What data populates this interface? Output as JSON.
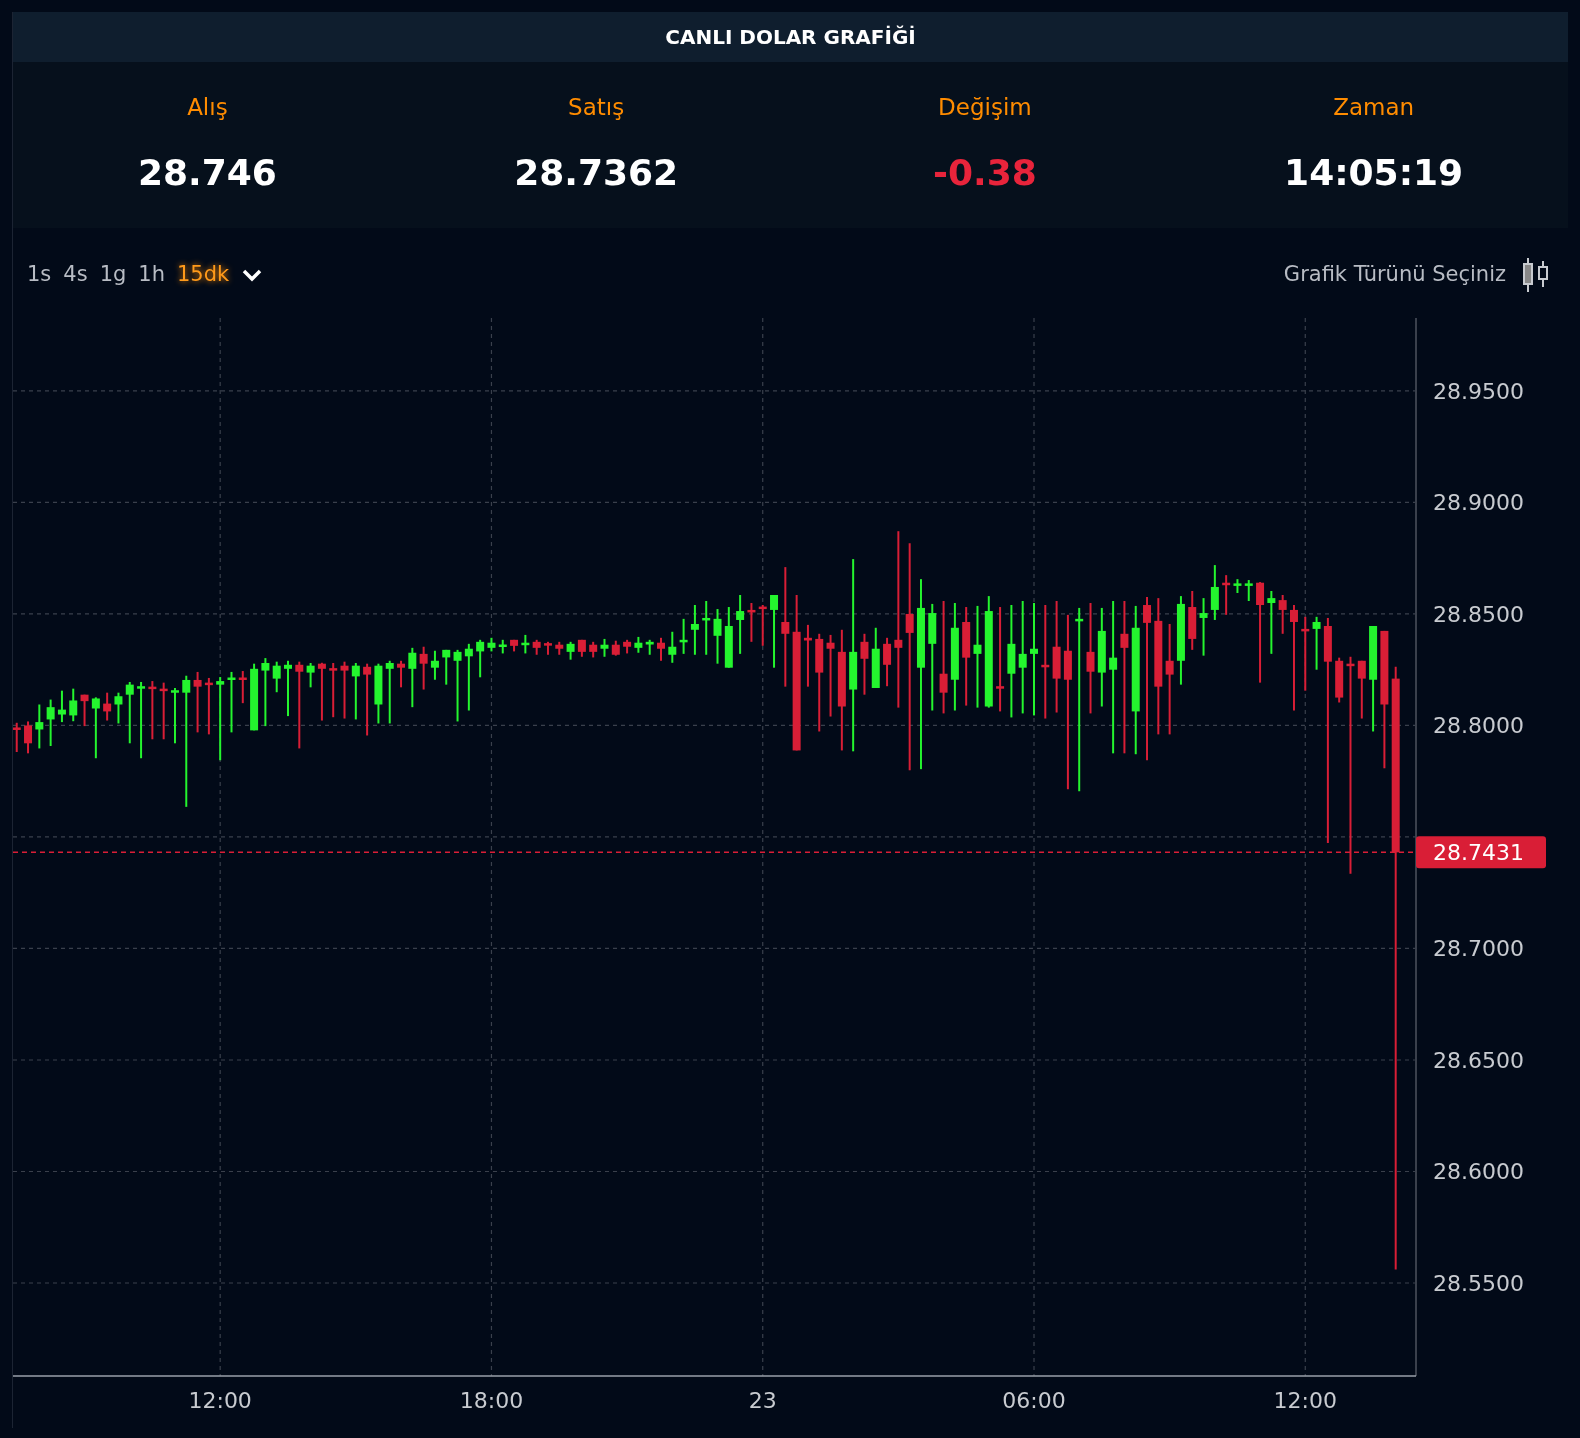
{
  "title": "CANLI DOLAR GRAFİĞİ",
  "stats": [
    {
      "label": "Alış",
      "value": "28.746",
      "color": "#ffffff"
    },
    {
      "label": "Satış",
      "value": "28.7362",
      "color": "#ffffff"
    },
    {
      "label": "Değişim",
      "value": "-0.38",
      "color": "#e8243b"
    },
    {
      "label": "Zaman",
      "value": "14:05:19",
      "color": "#ffffff"
    }
  ],
  "toolbar": {
    "intervals": [
      {
        "label": "1s",
        "selected": false
      },
      {
        "label": "4s",
        "selected": false
      },
      {
        "label": "1g",
        "selected": false
      },
      {
        "label": "1h",
        "selected": false
      },
      {
        "label": "15dk",
        "selected": true
      }
    ],
    "chart_type_label": "Grafik Türünü Seçiniz"
  },
  "chart_data": {
    "type": "candlestick",
    "ylim": [
      28.5083,
      28.9827
    ],
    "grid": true,
    "yticks": [
      {
        "value": 28.55,
        "label": "28.5500"
      },
      {
        "value": 28.6,
        "label": "28.6000"
      },
      {
        "value": 28.65,
        "label": "28.6500"
      },
      {
        "value": 28.7,
        "label": "28.7000"
      },
      {
        "value": 28.8,
        "label": "28.8000"
      },
      {
        "value": 28.85,
        "label": "28.8500"
      },
      {
        "value": 28.9,
        "label": "28.9000"
      },
      {
        "value": 28.95,
        "label": "28.9500"
      }
    ],
    "categories": [
      null,
      null,
      null,
      null,
      null,
      null,
      null,
      null,
      null,
      null,
      null,
      null,
      null,
      null,
      null,
      null,
      null,
      null,
      "12:00",
      null,
      null,
      null,
      null,
      null,
      null,
      null,
      null,
      null,
      null,
      null,
      null,
      null,
      null,
      null,
      null,
      null,
      null,
      null,
      null,
      null,
      null,
      null,
      "18:00",
      null,
      null,
      null,
      null,
      null,
      null,
      null,
      null,
      null,
      null,
      null,
      null,
      null,
      null,
      null,
      null,
      null,
      null,
      null,
      null,
      null,
      null,
      null,
      "23",
      null,
      null,
      null,
      null,
      null,
      null,
      null,
      null,
      null,
      null,
      null,
      null,
      null,
      null,
      null,
      null,
      null,
      null,
      null,
      null,
      null,
      null,
      null,
      "06:00",
      null,
      null,
      null,
      null,
      null,
      null,
      null,
      null,
      null,
      null,
      null,
      null,
      null,
      null,
      null,
      null,
      null,
      null,
      null,
      null,
      null,
      null,
      null,
      "12:00",
      null,
      null,
      null,
      null,
      null,
      null,
      null,
      null
    ],
    "ohlc": [
      [
        28.7991,
        28.8012,
        28.7881,
        28.7985
      ],
      [
        28.8,
        28.8018,
        28.7875,
        28.792
      ],
      [
        28.7982,
        28.8094,
        28.7897,
        28.8015
      ],
      [
        28.8027,
        28.8116,
        28.7908,
        28.8082
      ],
      [
        28.8049,
        28.8156,
        28.8015,
        28.8071
      ],
      [
        28.8045,
        28.8165,
        28.8019,
        28.8112
      ],
      [
        28.8138,
        28.8138,
        28.7997,
        28.8109
      ],
      [
        28.8076,
        28.8126,
        28.7853,
        28.8121
      ],
      [
        28.8098,
        28.8147,
        28.8022,
        28.8063
      ],
      [
        28.8094,
        28.8147,
        28.8009,
        28.8131
      ],
      [
        28.8138,
        28.8195,
        28.792,
        28.8183
      ],
      [
        28.8174,
        28.8195,
        28.7853,
        28.8176
      ],
      [
        28.8174,
        28.8199,
        28.7938,
        28.8171
      ],
      [
        28.8165,
        28.8192,
        28.7938,
        28.8162
      ],
      [
        28.8154,
        28.8168,
        28.792,
        28.8158
      ],
      [
        28.8147,
        28.8223,
        28.7635,
        28.8204
      ],
      [
        28.8204,
        28.824,
        28.7969,
        28.8174
      ],
      [
        28.8192,
        28.8213,
        28.796,
        28.8188
      ],
      [
        28.8183,
        28.8217,
        28.7844,
        28.8199
      ],
      [
        28.8211,
        28.824,
        28.7969,
        28.8215
      ],
      [
        28.8215,
        28.8244,
        28.81,
        28.8211
      ],
      [
        28.7978,
        28.8277,
        28.7978,
        28.8254
      ],
      [
        28.8246,
        28.8302,
        28.7997,
        28.828
      ],
      [
        28.821,
        28.8286,
        28.8149,
        28.8268
      ],
      [
        28.8254,
        28.829,
        28.8042,
        28.8272
      ],
      [
        28.8272,
        28.8286,
        28.7897,
        28.8241
      ],
      [
        28.8237,
        28.828,
        28.8171,
        28.8268
      ],
      [
        28.8277,
        28.8281,
        28.8022,
        28.8254
      ],
      [
        28.8257,
        28.828,
        28.8037,
        28.8246
      ],
      [
        28.8268,
        28.8286,
        28.8031,
        28.8246
      ],
      [
        28.822,
        28.828,
        28.8027,
        28.8268
      ],
      [
        28.8263,
        28.8277,
        28.7955,
        28.8228
      ],
      [
        28.8094,
        28.8277,
        28.8009,
        28.8268
      ],
      [
        28.8254,
        28.829,
        28.8009,
        28.828
      ],
      [
        28.8277,
        28.829,
        28.8171,
        28.8259
      ],
      [
        28.8254,
        28.8348,
        28.8082,
        28.8326
      ],
      [
        28.8321,
        28.8353,
        28.8161,
        28.8277
      ],
      [
        28.8259,
        28.8335,
        28.8205,
        28.829
      ],
      [
        28.8305,
        28.8339,
        28.8183,
        28.8339
      ],
      [
        28.829,
        28.8339,
        28.8018,
        28.833
      ],
      [
        28.831,
        28.8366,
        28.8067,
        28.8344
      ],
      [
        28.8332,
        28.8384,
        28.8216,
        28.8375
      ],
      [
        28.8348,
        28.8393,
        28.8332,
        28.8371
      ],
      [
        28.8362,
        28.8384,
        28.8323,
        28.8363
      ],
      [
        28.8384,
        28.8384,
        28.8332,
        28.8357
      ],
      [
        28.836,
        28.8406,
        28.8323,
        28.8371
      ],
      [
        28.8375,
        28.8384,
        28.8317,
        28.8348
      ],
      [
        28.8369,
        28.8375,
        28.8317,
        28.8367
      ],
      [
        28.8362,
        28.8375,
        28.8317,
        28.8344
      ],
      [
        28.833,
        28.8375,
        28.8295,
        28.8366
      ],
      [
        28.8384,
        28.8384,
        28.8308,
        28.833
      ],
      [
        28.8362,
        28.8375,
        28.8305,
        28.833
      ],
      [
        28.8344,
        28.8388,
        28.8308,
        28.8362
      ],
      [
        28.8362,
        28.838,
        28.8313,
        28.8317
      ],
      [
        28.8375,
        28.8384,
        28.8323,
        28.8353
      ],
      [
        28.8348,
        28.8397,
        28.8326,
        28.8371
      ],
      [
        28.8363,
        28.8384,
        28.8317,
        28.8375
      ],
      [
        28.8371,
        28.8393,
        28.829,
        28.8344
      ],
      [
        28.8317,
        28.842,
        28.8281,
        28.8353
      ],
      [
        28.8378,
        28.8478,
        28.8321,
        28.8384
      ],
      [
        28.8429,
        28.854,
        28.8317,
        28.8455
      ],
      [
        28.8473,
        28.8558,
        28.8317,
        28.8482
      ],
      [
        28.8402,
        28.8522,
        28.8277,
        28.8478
      ],
      [
        28.8259,
        28.8531,
        28.8259,
        28.8446
      ],
      [
        28.8473,
        28.8585,
        28.8321,
        28.8513
      ],
      [
        28.8518,
        28.8549,
        28.8375,
        28.8509
      ],
      [
        28.8533,
        28.854,
        28.8357,
        28.8527
      ],
      [
        28.8518,
        28.8585,
        28.8259,
        28.8585
      ],
      [
        28.8464,
        28.871,
        28.8174,
        28.8411
      ],
      [
        28.842,
        28.8585,
        28.7888,
        28.7888
      ],
      [
        28.8393,
        28.8451,
        28.8174,
        28.8381
      ],
      [
        28.8388,
        28.8411,
        28.7973,
        28.8237
      ],
      [
        28.8371,
        28.8406,
        28.804,
        28.8344
      ],
      [
        28.833,
        28.8429,
        28.7888,
        28.8085
      ],
      [
        28.8161,
        28.8746,
        28.7884,
        28.833
      ],
      [
        28.8375,
        28.8411,
        28.8138,
        28.8299
      ],
      [
        28.8168,
        28.8438,
        28.8168,
        28.8344
      ],
      [
        28.8366,
        28.8393,
        28.8176,
        28.8272
      ],
      [
        28.8384,
        28.8871,
        28.808,
        28.8348
      ],
      [
        28.85,
        28.8817,
        28.7799,
        28.8415
      ],
      [
        28.8259,
        28.8656,
        28.7804,
        28.8527
      ],
      [
        28.8366,
        28.8545,
        28.8067,
        28.8504
      ],
      [
        28.8232,
        28.8558,
        28.8054,
        28.8147
      ],
      [
        28.8205,
        28.8549,
        28.8067,
        28.8438
      ],
      [
        28.8464,
        28.8531,
        28.8089,
        28.8304
      ],
      [
        28.8321,
        28.8536,
        28.808,
        28.8362
      ],
      [
        28.8085,
        28.858,
        28.808,
        28.8513
      ],
      [
        28.8176,
        28.8531,
        28.8063,
        28.817
      ],
      [
        28.8232,
        28.854,
        28.8036,
        28.8366
      ],
      [
        28.8259,
        28.8558,
        28.8054,
        28.8321
      ],
      [
        28.8321,
        28.8549,
        28.8045,
        28.8344
      ],
      [
        28.8272,
        28.854,
        28.8031,
        28.8268
      ],
      [
        28.8353,
        28.8558,
        28.8058,
        28.821
      ],
      [
        28.8335,
        28.8496,
        28.7714,
        28.8205
      ],
      [
        28.8469,
        28.8527,
        28.7705,
        28.8478
      ],
      [
        28.833,
        28.8549,
        28.8054,
        28.8241
      ],
      [
        28.8237,
        28.8527,
        28.8085,
        28.8424
      ],
      [
        28.825,
        28.8558,
        28.7875,
        28.8304
      ],
      [
        28.8411,
        28.8558,
        28.7875,
        28.8348
      ],
      [
        28.8063,
        28.8536,
        28.7871,
        28.8438
      ],
      [
        28.854,
        28.8576,
        28.7844,
        28.846
      ],
      [
        28.8469,
        28.8571,
        28.796,
        28.8174
      ],
      [
        28.829,
        28.8455,
        28.796,
        28.8228
      ],
      [
        28.829,
        28.858,
        28.8183,
        28.8545
      ],
      [
        28.8531,
        28.8603,
        28.8339,
        28.8388
      ],
      [
        28.8482,
        28.8571,
        28.8313,
        28.8504
      ],
      [
        28.8518,
        28.8719,
        28.8473,
        28.8621
      ],
      [
        28.864,
        28.8674,
        28.8496,
        28.8637
      ],
      [
        28.8626,
        28.8656,
        28.8594,
        28.8637
      ],
      [
        28.8626,
        28.8652,
        28.8558,
        28.8637
      ],
      [
        28.864,
        28.8643,
        28.8192,
        28.854
      ],
      [
        28.8549,
        28.8603,
        28.8321,
        28.8571
      ],
      [
        28.8562,
        28.8585,
        28.8411,
        28.8518
      ],
      [
        28.8518,
        28.854,
        28.8067,
        28.8464
      ],
      [
        28.8433,
        28.8487,
        28.8156,
        28.8429
      ],
      [
        28.8433,
        28.8487,
        28.825,
        28.8464
      ],
      [
        28.8446,
        28.8482,
        28.7473,
        28.8286
      ],
      [
        28.829,
        28.8304,
        28.8103,
        28.8125
      ],
      [
        28.8277,
        28.8308,
        28.7335,
        28.8272
      ],
      [
        28.829,
        28.829,
        28.8031,
        28.821
      ],
      [
        28.8205,
        28.8446,
        28.7973,
        28.8446
      ],
      [
        28.8424,
        28.8424,
        28.7808,
        28.8094
      ],
      [
        28.821,
        28.8263,
        28.556,
        28.7431
      ]
    ],
    "ref_lines": [
      {
        "axis": "y",
        "value": 28.7431,
        "label": "28.7431"
      }
    ]
  }
}
